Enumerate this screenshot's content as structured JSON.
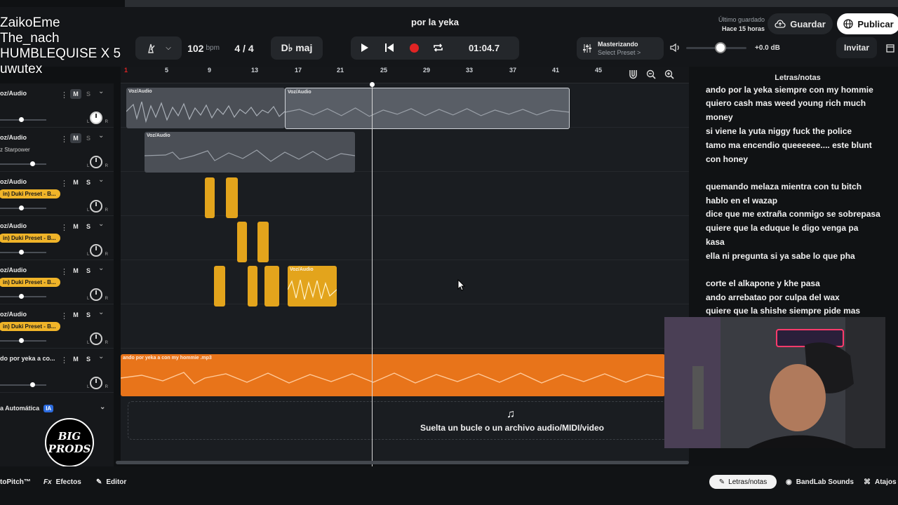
{
  "overlay_names": [
    "ZaikoEme",
    "The_nach",
    "HUMBLEQUISE X 5",
    "uwutex"
  ],
  "header": {
    "project_title": "por la yeka",
    "bpm_value": "102",
    "bpm_unit": "bpm",
    "time_signature": "4 / 4",
    "key": "D♭ maj",
    "timecode": "01:04.7",
    "saved_label": "Último guardado",
    "saved_time": "Hace 15 horas",
    "save_label": "Guardar",
    "publish_label": "Publicar",
    "master_title": "Masterizando",
    "master_preset": "Select Preset >",
    "volume_db": "+0.0 dB",
    "invite_label": "Invitar",
    "volume_level": 0.5
  },
  "ruler": [
    "1",
    "5",
    "9",
    "13",
    "17",
    "21",
    "25",
    "29",
    "33",
    "37",
    "41",
    "45"
  ],
  "tracks": [
    {
      "name": "oz/Audio",
      "sub": "",
      "preset": "",
      "mute_on": true,
      "fader": 0.45
    },
    {
      "name": "oz/Audio",
      "sub": "z Starpower",
      "preset": "",
      "mute_on": true,
      "fader": 0.7
    },
    {
      "name": "oz/Audio",
      "sub": "",
      "preset": "in) Duki Preset - B...",
      "mute_on": false,
      "fader": 0.45
    },
    {
      "name": "oz/Audio",
      "sub": "",
      "preset": "in) Duki Preset - B...",
      "mute_on": false,
      "fader": 0.45
    },
    {
      "name": "oz/Audio",
      "sub": "",
      "preset": "in) Duki Preset - B...",
      "mute_on": false,
      "fader": 0.45
    },
    {
      "name": "oz/Audio",
      "sub": "",
      "preset": "in) Duki Preset - B...",
      "mute_on": false,
      "fader": 0.45
    },
    {
      "name": "do por yeka a co...",
      "sub": "",
      "preset": "",
      "mute_on": false,
      "fader": 0.7
    }
  ],
  "track_buttons": {
    "mute": "M",
    "solo": "S",
    "left": "L",
    "right": "R"
  },
  "automation": {
    "label": "a Automática",
    "badge": "IA"
  },
  "logo": {
    "line1": "BIG",
    "line2": "PRODS"
  },
  "clips": {
    "voz_label": "Voz/Audio",
    "mp3_label": "ando por yeka a con my hommie .mp3"
  },
  "dropzone_text": "Suelta un bucle o un archivo audio/MIDI/video",
  "lyrics": {
    "title": "Letras/notas",
    "lines": [
      " ando por la  yeka siempre con my hommie",
      "quiero cash mas weed  young rich  much",
      "money",
      "si viene la yuta niggy fuck the police",
      " tamo ma encendio queeeeee.... este blunt",
      "con honey",
      "",
      "quemando melaza mientra con tu bitch",
      "hablo en el wazap",
      "dice que me extraña conmigo se sobrepasa",
      " quiere que la eduque le digo venga pa",
      "kasa",
      "ella ni pregunta si ya sabe lo que pha",
      "",
      " corte el alkapone y khe pasa",
      "ando arrebatao por culpa del wax",
      "quiere que la shishe siempre pide mas"
    ]
  },
  "bottom": {
    "autopitch": "toPitch™",
    "effects_prefix": "Fx",
    "effects": "Efectos",
    "editor": "Editor",
    "lyrics_tab": "Letras/notas",
    "sounds": "BandLab Sounds",
    "shortcuts": "Atajos"
  },
  "colors": {
    "record": "#e02424",
    "clip_yellow": "#e3a41c",
    "clip_orange": "#e8741a",
    "badge_blue": "#2d6cdf"
  }
}
